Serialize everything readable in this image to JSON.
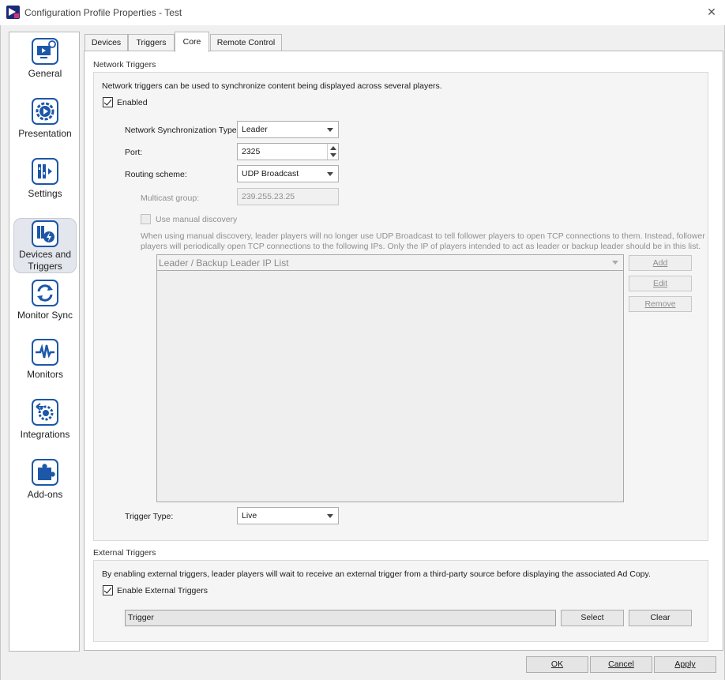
{
  "window": {
    "title": "Configuration Profile Properties - Test",
    "close_glyph": "✕"
  },
  "sidebar": {
    "items": [
      {
        "label": "General",
        "icon": "monitor-settings-icon"
      },
      {
        "label": "Presentation",
        "icon": "play-gear-icon"
      },
      {
        "label": "Settings",
        "icon": "sliders-icon"
      },
      {
        "label": "Devices and Triggers",
        "icon": "devices-lightning-icon"
      },
      {
        "label": "Monitor Sync",
        "icon": "sync-arrows-icon"
      },
      {
        "label": "Monitors",
        "icon": "heartbeat-icon"
      },
      {
        "label": "Integrations",
        "icon": "integration-gear-icon"
      },
      {
        "label": "Add-ons",
        "icon": "puzzle-icon"
      }
    ],
    "active": "Devices and Triggers"
  },
  "tabs": [
    {
      "label": "Devices"
    },
    {
      "label": "Triggers"
    },
    {
      "label": "Core"
    },
    {
      "label": "Remote Control"
    }
  ],
  "network_triggers": {
    "title": "Network Triggers",
    "description": "Network triggers can be used to synchronize content being displayed across several players.",
    "enabled_label": "Enabled",
    "enabled": true,
    "sync_type_label": "Network Synchronization Type:",
    "sync_type_value": "Leader",
    "port_label": "Port:",
    "port_value": "2325",
    "routing_label": "Routing scheme:",
    "routing_value": "UDP Broadcast",
    "multicast_label": "Multicast group:",
    "multicast_value": "239.255.23.25",
    "manual_discovery_label": "Use manual discovery",
    "manual_discovery_line1": "When using manual discovery, leader players will no longer use UDP Broadcast to tell follower players to open TCP connections to them. Instead, follower",
    "manual_discovery_line2": "players will periodically open TCP connections to the following IPs. Only the IP of players intended to act as leader or backup leader should be in this list.",
    "ip_list_header": "Leader / Backup Leader IP List",
    "add_label": "Add",
    "edit_label": "Edit",
    "remove_label": "Remove",
    "trigger_type_label": "Trigger Type:",
    "trigger_type_value": "Live"
  },
  "external_triggers": {
    "title": "External Triggers",
    "description": "By enabling external triggers, leader players will wait to receive an external trigger from a third-party source before displaying the associated Ad Copy.",
    "enable_label": "Enable External Triggers",
    "enabled": true,
    "trigger_value": "Trigger",
    "select_label": "Select",
    "clear_label": "Clear"
  },
  "dialog_buttons": {
    "ok": "OK",
    "cancel": "Cancel",
    "apply": "Apply"
  }
}
